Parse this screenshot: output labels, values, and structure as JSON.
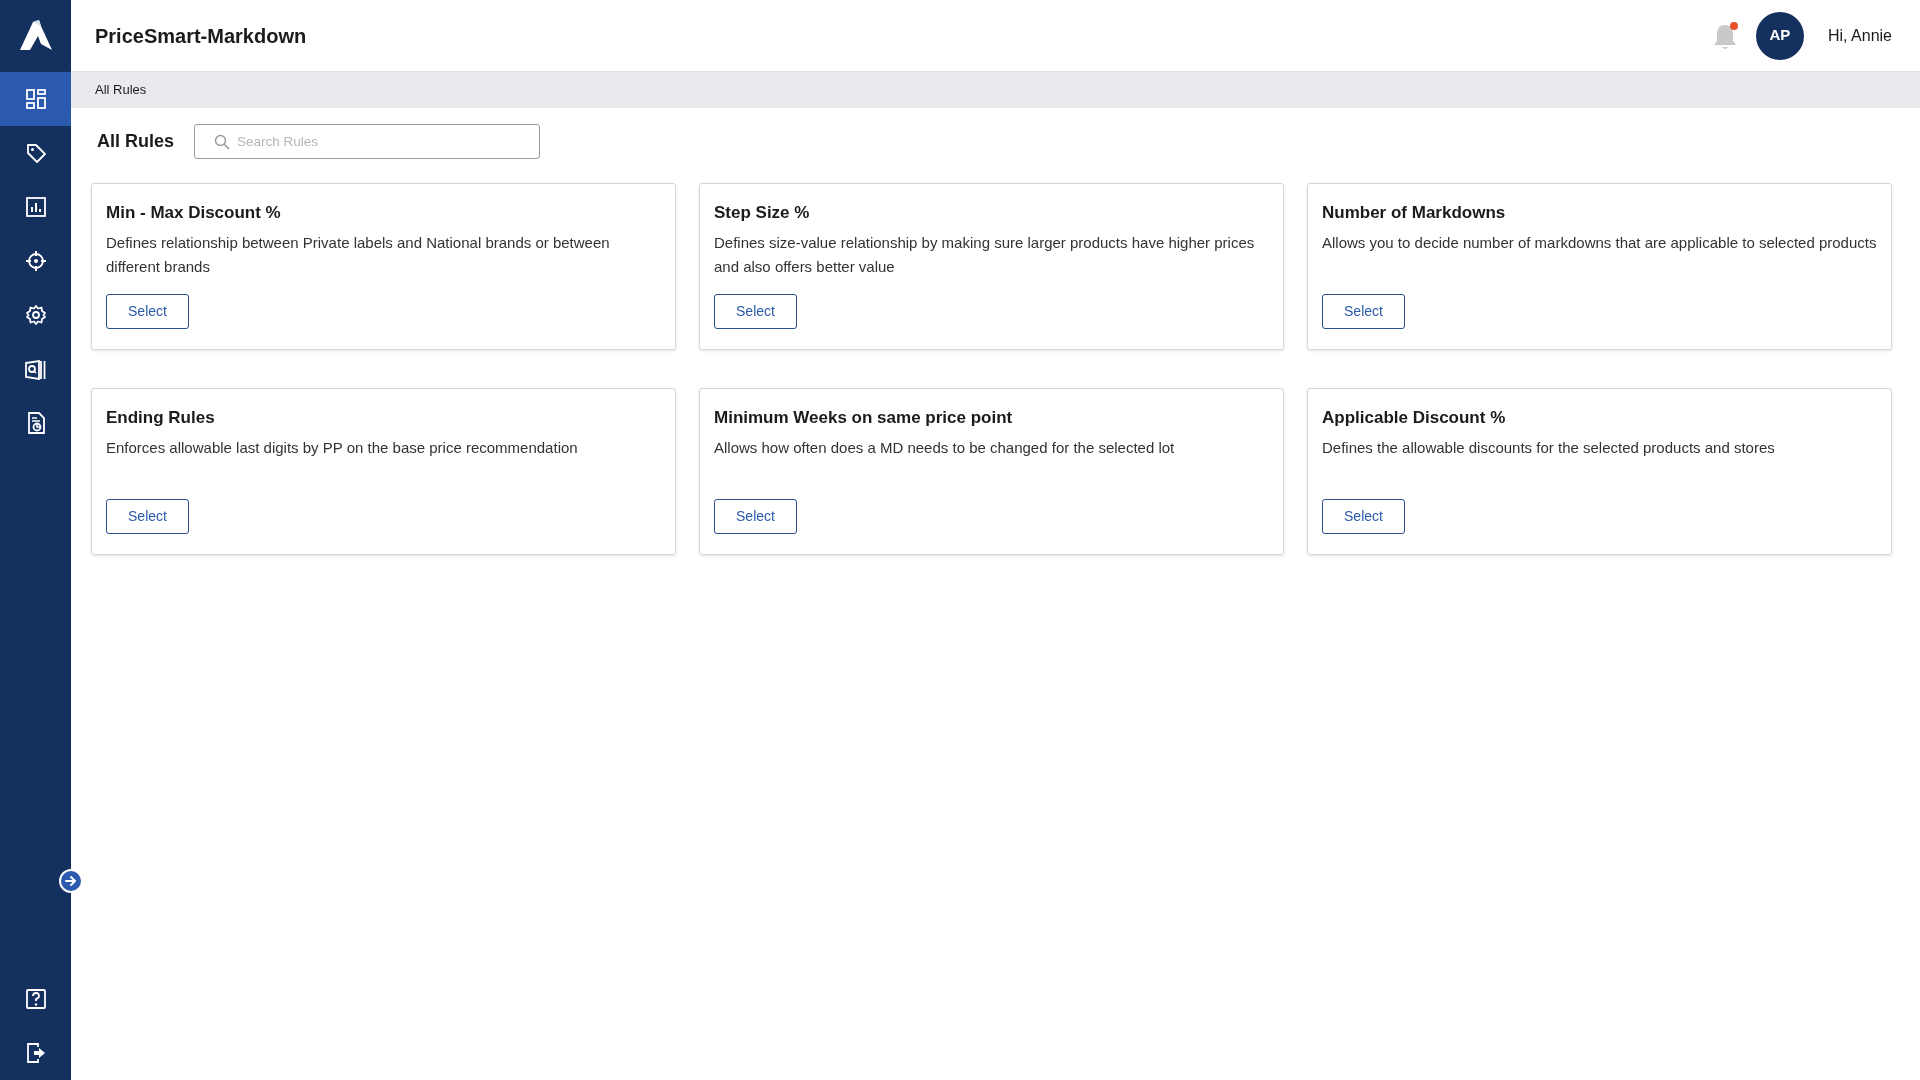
{
  "app": {
    "title": "PriceSmart-Markdown"
  },
  "sidebar": {
    "items": [
      {
        "selected": true
      },
      {
        "selected": false
      },
      {
        "selected": false
      },
      {
        "selected": false
      },
      {
        "selected": false
      },
      {
        "selected": false
      },
      {
        "selected": false
      }
    ],
    "bottom_items": [
      {
        "selected": false
      },
      {
        "selected": false
      }
    ]
  },
  "header": {
    "notifications_unread": true,
    "avatar_initials": "AP",
    "greeting": "Hi, Annie"
  },
  "breadcrumb": [
    "All Rules"
  ],
  "page_title": "All Rules",
  "search": {
    "placeholder": "Search Rules"
  },
  "rules": [
    {
      "title": "Min - Max Discount %",
      "description": "Defines relationship between Private labels and National brands or between different brands",
      "button": "Select"
    },
    {
      "title": "Step Size %",
      "description": "Defines size-value relationship by making sure larger products have higher prices and also offers better value",
      "button": "Select"
    },
    {
      "title": "Number of Markdowns",
      "description": "Allows you to decide number of markdowns that are applicable to selected products",
      "button": "Select"
    },
    {
      "title": "Ending Rules",
      "description": "Enforces allowable last digits by PP on the base price recommendation",
      "button": "Select"
    },
    {
      "title": "Minimum Weeks on same price point",
      "description": "Allows how often does a MD needs to be changed for the selected lot",
      "button": "Select"
    },
    {
      "title": "Applicable Discount %",
      "description": "Defines the allowable discounts for the selected products and stores",
      "button": "Select"
    }
  ]
}
